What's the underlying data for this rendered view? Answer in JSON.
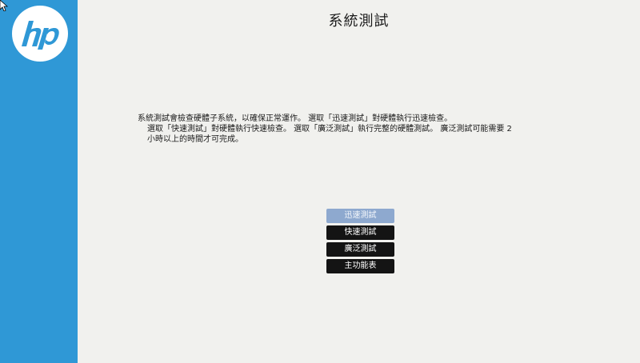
{
  "page": {
    "title": "系統測試"
  },
  "description": {
    "line1": "系統測試會檢查硬體子系統，以確保正常運作。 選取「迅速測試」對硬體執行迅速檢查。",
    "line2": "選取「快速測試」對硬體執行快速檢查。 選取「廣泛測試」執行完整的硬體測試。 廣泛測試可能需要 2",
    "line3": "小時以上的時間才可完成。"
  },
  "menu": {
    "items": [
      {
        "label": "迅速測試",
        "selected": true
      },
      {
        "label": "快速測試",
        "selected": false
      },
      {
        "label": "廣泛測試",
        "selected": false
      },
      {
        "label": "主功能表",
        "selected": false
      }
    ]
  },
  "colors": {
    "sidebar": "#2f98d6",
    "background": "#f1f1ee",
    "button": "#141414",
    "button_selected": "#8ea9cf"
  },
  "icons": {
    "logo": "hp-logo-icon",
    "cursor": "mouse-cursor-icon"
  }
}
